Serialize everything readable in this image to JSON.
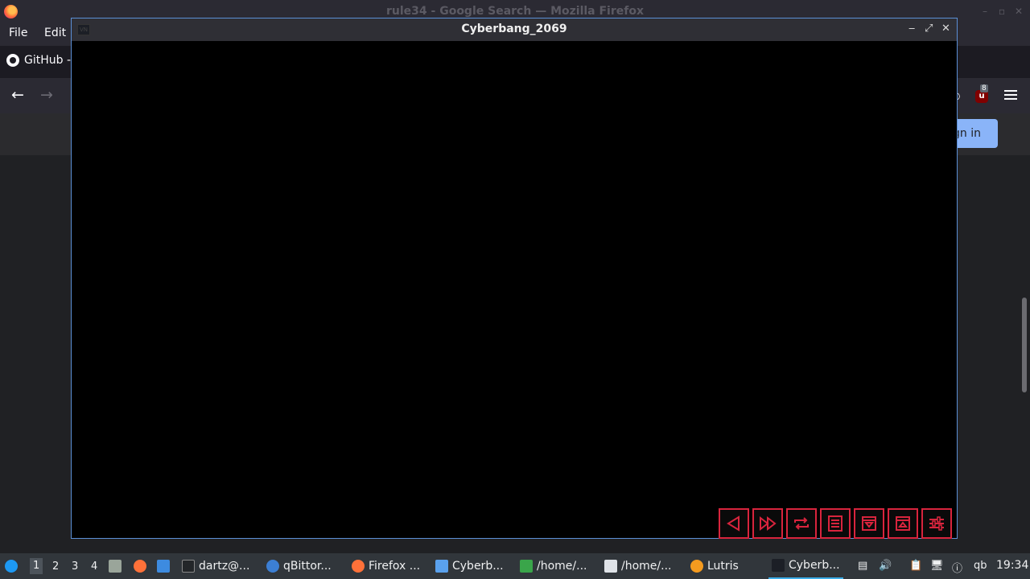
{
  "firefox": {
    "window_title": "rule34 - Google Search — Mozilla Firefox",
    "menu": [
      "File",
      "Edit"
    ],
    "tab_label": "GitHub -",
    "back_glyph": "←",
    "forward_glyph": "→",
    "ublock_badge": "8",
    "signin_label": "gn in",
    "win_minimize": "–",
    "win_maximize": "▫",
    "win_close": "✕"
  },
  "game_window": {
    "title": "Cyberbang_2069",
    "icon_label": "VN",
    "minimize": "‒",
    "maximize": "⤢",
    "close": "✕",
    "renpy_buttons": [
      {
        "name": "back",
        "icon": "triangle-left-icon"
      },
      {
        "name": "skip",
        "icon": "fast-forward-icon"
      },
      {
        "name": "auto",
        "icon": "repeat-icon"
      },
      {
        "name": "history",
        "icon": "history-icon"
      },
      {
        "name": "save",
        "icon": "save-icon"
      },
      {
        "name": "load",
        "icon": "load-icon"
      },
      {
        "name": "preferences",
        "icon": "settings-sliders-icon"
      }
    ],
    "accent_color": "#d8243d"
  },
  "taskbar": {
    "workspaces": [
      "1",
      "2",
      "3",
      "4"
    ],
    "current_workspace": "1",
    "tasks": [
      {
        "label": "dartz@...",
        "icon": "terminal-icon"
      },
      {
        "label": "qBittor...",
        "icon": "qbittorrent-icon"
      },
      {
        "label": "Firefox ...",
        "icon": "firefox-icon"
      },
      {
        "label": "Cyberb...",
        "icon": "folder-icon"
      },
      {
        "label": "/home/...",
        "icon": "archive-icon"
      },
      {
        "label": "/home/...",
        "icon": "text-editor-icon"
      },
      {
        "label": "Lutris",
        "icon": "lutris-icon"
      },
      {
        "label": "Cyberb...",
        "icon": "game-icon",
        "active": true
      }
    ],
    "tray_qb": "qb",
    "clock": "19:34"
  }
}
